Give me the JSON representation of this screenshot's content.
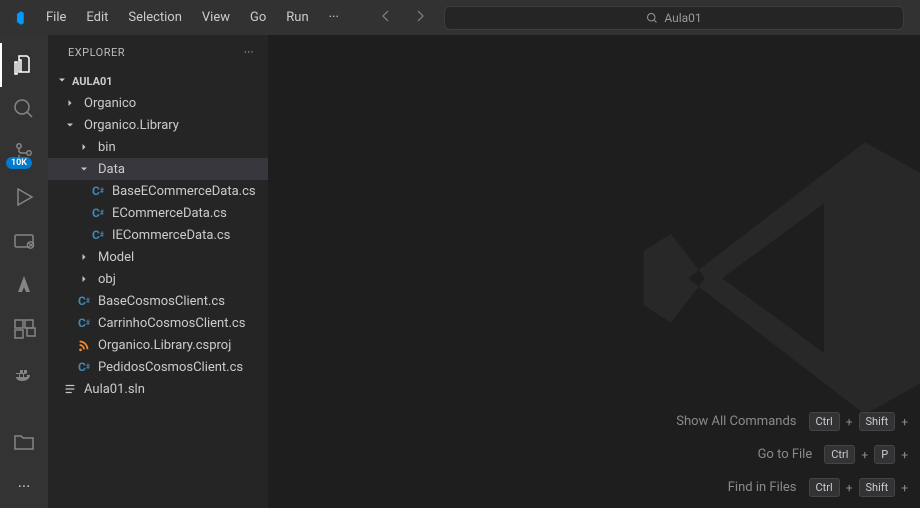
{
  "titlebar": {
    "menu": [
      "File",
      "Edit",
      "Selection",
      "View",
      "Go",
      "Run",
      "···"
    ],
    "search_text": "Aula01"
  },
  "activitybar": {
    "source_control_badge": "10K"
  },
  "sidebar": {
    "title": "EXPLORER",
    "root": "AULA01",
    "tree": [
      {
        "label": "Organico",
        "type": "folder",
        "expanded": false,
        "indent": 1
      },
      {
        "label": "Organico.Library",
        "type": "folder",
        "expanded": true,
        "indent": 1
      },
      {
        "label": "bin",
        "type": "folder",
        "expanded": false,
        "indent": 2
      },
      {
        "label": "Data",
        "type": "folder",
        "expanded": true,
        "indent": 2,
        "selected": true
      },
      {
        "label": "BaseECommerceData.cs",
        "type": "cs",
        "indent": 3
      },
      {
        "label": "ECommerceData.cs",
        "type": "cs",
        "indent": 3
      },
      {
        "label": "IECommerceData.cs",
        "type": "cs",
        "indent": 3
      },
      {
        "label": "Model",
        "type": "folder",
        "expanded": false,
        "indent": 2
      },
      {
        "label": "obj",
        "type": "folder",
        "expanded": false,
        "indent": 2
      },
      {
        "label": "BaseCosmosClient.cs",
        "type": "cs",
        "indent": 2
      },
      {
        "label": "CarrinhoCosmosClient.cs",
        "type": "cs",
        "indent": 2
      },
      {
        "label": "Organico.Library.csproj",
        "type": "rss",
        "indent": 2
      },
      {
        "label": "PedidosCosmosClient.cs",
        "type": "cs",
        "indent": 2
      },
      {
        "label": "Aula01.sln",
        "type": "lines",
        "indent": 1
      }
    ]
  },
  "shortcuts": [
    {
      "label": "Show All Commands",
      "keys": [
        "Ctrl",
        "Shift"
      ]
    },
    {
      "label": "Go to File",
      "keys": [
        "Ctrl",
        "P"
      ]
    },
    {
      "label": "Find in Files",
      "keys": [
        "Ctrl",
        "Shift"
      ]
    }
  ]
}
